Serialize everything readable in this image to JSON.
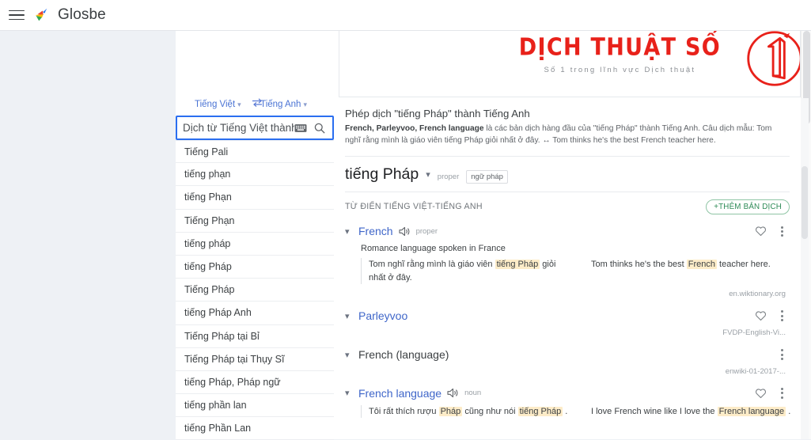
{
  "topbar": {
    "menu_icon": "hamburger-icon",
    "logo_icon": "glosbe-bird-logo",
    "brand": "Glosbe"
  },
  "banner": {
    "title": "DỊCH THUẬT SỐ",
    "subtitle": "Số 1 trong lĩnh vực Dịch thuật",
    "mark": "circled-number-one",
    "color": "#e8211a"
  },
  "search": {
    "source_lang": "Tiếng Việt",
    "target_lang": "Tiếng Anh",
    "swap_icon": "swap-arrows-icon",
    "chevron_icon": "chevron-down-icon",
    "keyboard_icon": "keyboard-icon",
    "search_icon": "search-icon",
    "input_value": "Dịch từ Tiếng Việt thành",
    "placeholder": "Dịch từ Tiếng Việt thành",
    "focus_color": "#2a6ef0",
    "suggestions": [
      "Tiếng Pali",
      "tiếng phạn",
      "tiếng Phạn",
      "Tiếng Phạn",
      "tiếng pháp",
      "tiếng Pháp",
      "Tiếng Pháp",
      "tiếng Pháp Anh",
      "Tiếng Pháp tại Bỉ",
      "Tiếng Pháp tại Thụy Sĩ",
      "tiếng Pháp, Pháp ngữ",
      "tiếng phần lan",
      "tiếng Phần Lan"
    ]
  },
  "main": {
    "doc_title": "Phép dịch \"tiếng Pháp\" thành Tiếng Anh",
    "doc_desc_bold": "French, Parleyvoo, French language",
    "doc_desc_rest": " là các bản dịch hàng đầu của \"tiếng Pháp\" thành Tiếng Anh. Câu dịch mẫu: Tom nghĩ rằng mình là giáo viên tiếng Pháp giỏi nhất ở đây. ↔ Tom thinks he's the best French teacher here.",
    "headword": "tiếng Pháp",
    "headword_pos": "proper",
    "headword_badge": "ngữ pháp",
    "dictionary_label": "TỪ ĐIỂN TIẾNG VIỆT-TIẾNG ANH",
    "add_translation_button": "+THÊM BẢN DỊCH",
    "add_button_color": "#2e8b57",
    "entries": [
      {
        "term": "French",
        "term_style": "link",
        "has_speaker": true,
        "pos": "proper",
        "has_heart": true,
        "definition": "Romance language spoken in France",
        "example_source_pre": "Tom nghĩ rằng mình là giáo viên ",
        "example_source_hl": "tiếng Pháp",
        "example_source_post": " giỏi nhất ở đây.",
        "example_target_pre": "Tom thinks he's the best ",
        "example_target_hl": "French",
        "example_target_post": " teacher here.",
        "source": "en.wiktionary.org"
      },
      {
        "term": "Parleyvoo",
        "term_style": "link",
        "has_speaker": false,
        "pos": "",
        "has_heart": true,
        "source": "FVDP-English-Vi..."
      },
      {
        "term": "French (language)",
        "term_style": "plain",
        "has_speaker": false,
        "pos": "",
        "has_heart": false,
        "source": "enwiki-01-2017-..."
      },
      {
        "term": "French language",
        "term_style": "link",
        "has_speaker": true,
        "pos": "noun",
        "has_heart": true,
        "example_source_pre": "Tôi rất thích rượu ",
        "example_source_hl": "Pháp",
        "example_source_mid": " cũng như nói ",
        "example_source_hl2": "tiếng Pháp",
        "example_source_post": " .",
        "example_target_pre": "I love French wine like I love the ",
        "example_target_hl": "French language",
        "example_target_post": " ."
      }
    ]
  }
}
